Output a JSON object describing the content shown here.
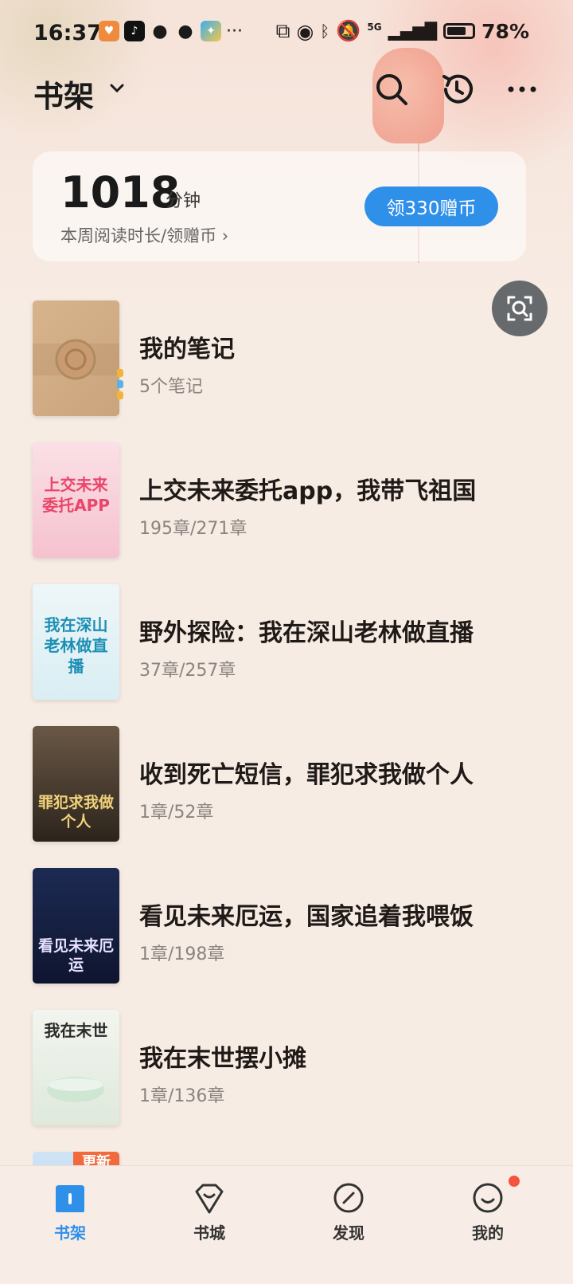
{
  "status_bar": {
    "time": "16:37",
    "battery": "78%",
    "network": "5G",
    "battery_level": 0.78
  },
  "header": {
    "title": "书架"
  },
  "reading_card": {
    "minutes": "1018",
    "unit": "分钟",
    "subtitle": "本周阅读时长/领赠币 ›",
    "claim_label": "领330赠币"
  },
  "notes": {
    "title": "我的笔记",
    "count": "5个笔记"
  },
  "books": [
    {
      "title": "上交未来委托app，我带飞祖国",
      "progress": "195章/271章",
      "cover_text": "上交未来委托APP"
    },
    {
      "title": "野外探险：我在深山老林做直播",
      "progress": "37章/257章",
      "cover_text": "我在深山老林做直播"
    },
    {
      "title": "收到死亡短信，罪犯求我做个人",
      "progress": "1章/52章",
      "cover_text": "罪犯求我做个人"
    },
    {
      "title": "看见未来厄运，国家追着我喂饭",
      "progress": "1章/198章",
      "cover_text": "看见未来厄运"
    },
    {
      "title": "我在末世摆小摊",
      "progress": "1章/136章",
      "cover_text": "我在末世"
    }
  ],
  "partial_book": {
    "badge": "更新"
  },
  "bottom_nav": [
    {
      "label": "书架",
      "active": true
    },
    {
      "label": "书城",
      "active": false
    },
    {
      "label": "发现",
      "active": false
    },
    {
      "label": "我的",
      "active": false
    }
  ],
  "colors": {
    "accent": "#2f90ea",
    "background": "#f7ece4",
    "badge": "#f06a3c",
    "notification_dot": "#f4543f"
  }
}
